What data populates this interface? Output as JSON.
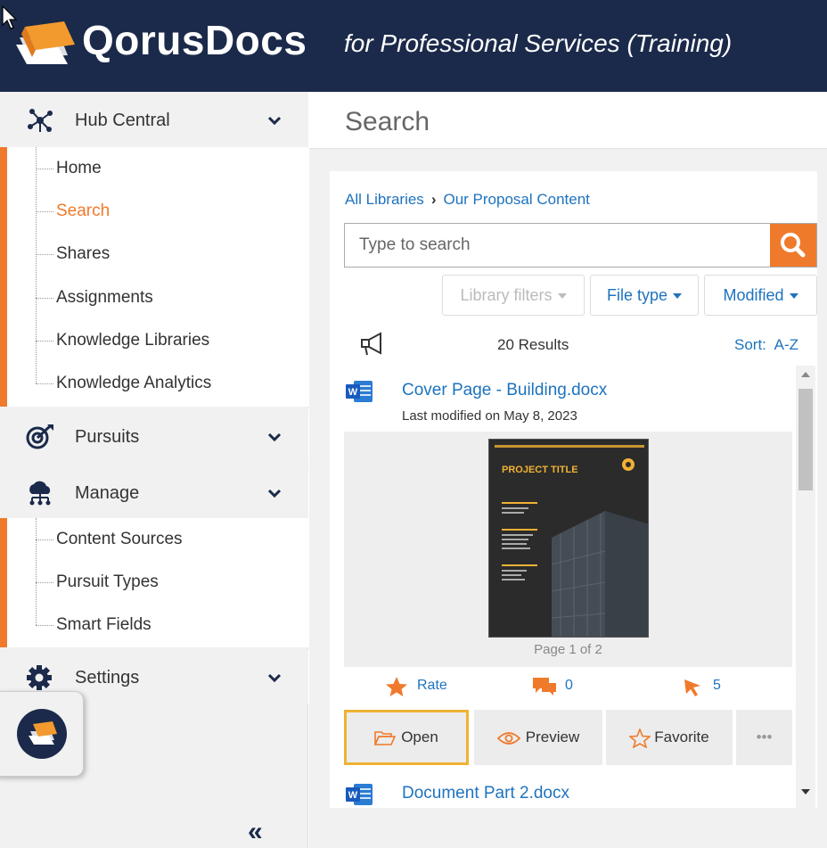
{
  "header": {
    "brand": "QorusDocs",
    "tagline": "for Professional Services (Training)"
  },
  "sidebar": {
    "hub": {
      "label": "Hub Central",
      "items": [
        "Home",
        "Search",
        "Shares",
        "Assignments",
        "Knowledge Libraries",
        "Knowledge Analytics"
      ],
      "active": "Search"
    },
    "pursuits": {
      "label": "Pursuits"
    },
    "manage": {
      "label": "Manage",
      "items": [
        "Content Sources",
        "Pursuit Types",
        "Smart Fields"
      ]
    },
    "settings": {
      "label": "Settings"
    },
    "collapse": "«"
  },
  "main": {
    "title": "Search",
    "breadcrumb": [
      "All Libraries",
      "Our Proposal Content"
    ],
    "search_placeholder": "Type to search",
    "filters": [
      "Library filters",
      "File type",
      "Modified"
    ],
    "results_count": "20 Results",
    "sort_label": "Sort:",
    "sort_value": "A-Z",
    "results": [
      {
        "title": "Cover Page - Building.docx",
        "modified": "Last modified on May 8, 2023",
        "page_indicator": "Page 1 of 2",
        "rate_label": "Rate",
        "comments": "0",
        "clicks": "5",
        "thumb_title": "PROJECT TITLE"
      },
      {
        "title": "Document Part 2.docx"
      }
    ],
    "actions": [
      "Open",
      "Preview",
      "Favorite",
      "•••"
    ]
  },
  "colors": {
    "brand_navy": "#1b2a4a",
    "accent_orange": "#f07a2b",
    "link_blue": "#1e73be",
    "highlight": "#f0b233"
  }
}
